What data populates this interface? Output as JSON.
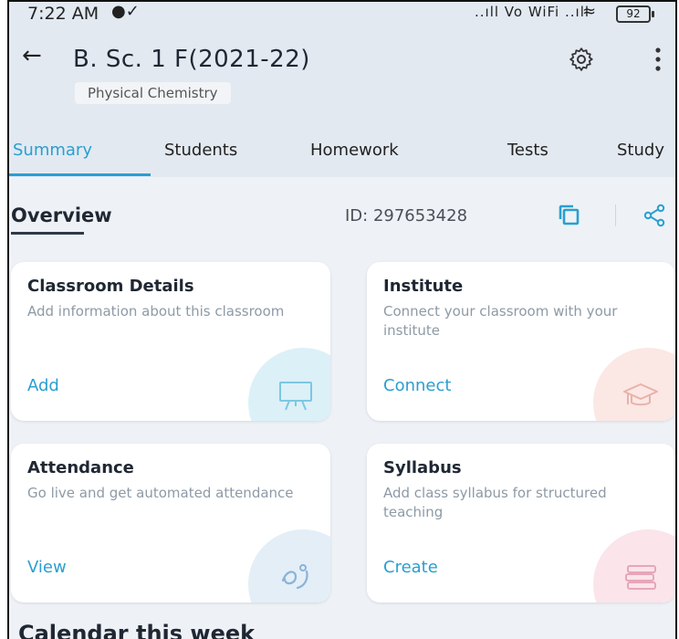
{
  "status_bar": {
    "time": "7:22 AM",
    "network": "..ıll Vo WiFi ..ıll",
    "battery": "92"
  },
  "header": {
    "title": "B. Sc. 1 F(2021-22)",
    "subject": "Physical Chemistry"
  },
  "tabs": [
    {
      "label": "Summary",
      "active": true
    },
    {
      "label": "Students",
      "active": false
    },
    {
      "label": "Homework",
      "active": false
    },
    {
      "label": "Tests",
      "active": false
    },
    {
      "label": "Study",
      "active": false
    }
  ],
  "overview": {
    "title": "Overview",
    "id_text": "ID: 297653428"
  },
  "cards": [
    {
      "title": "Classroom Details",
      "description": "Add information about this classroom",
      "action": "Add",
      "icon": "whiteboard-icon",
      "accent": "#d8f0f8"
    },
    {
      "title": "Institute",
      "description": "Connect your classroom with your institute",
      "action": "Connect",
      "icon": "graduation-cap-icon",
      "accent": "#fbe6e3"
    },
    {
      "title": "Attendance",
      "description": "Go live and get automated attendance",
      "action": "View",
      "icon": "attendance-icon",
      "accent": "#e3eef7"
    },
    {
      "title": "Syllabus",
      "description": "Add class syllabus for structured teaching",
      "action": "Create",
      "icon": "books-icon",
      "accent": "#fbe3ea"
    }
  ],
  "calendar": {
    "title": "Calendar this week"
  },
  "colors": {
    "accent": "#2a9fd0",
    "header_bg": "#e2e9f1",
    "page_bg": "#eef2f6"
  }
}
